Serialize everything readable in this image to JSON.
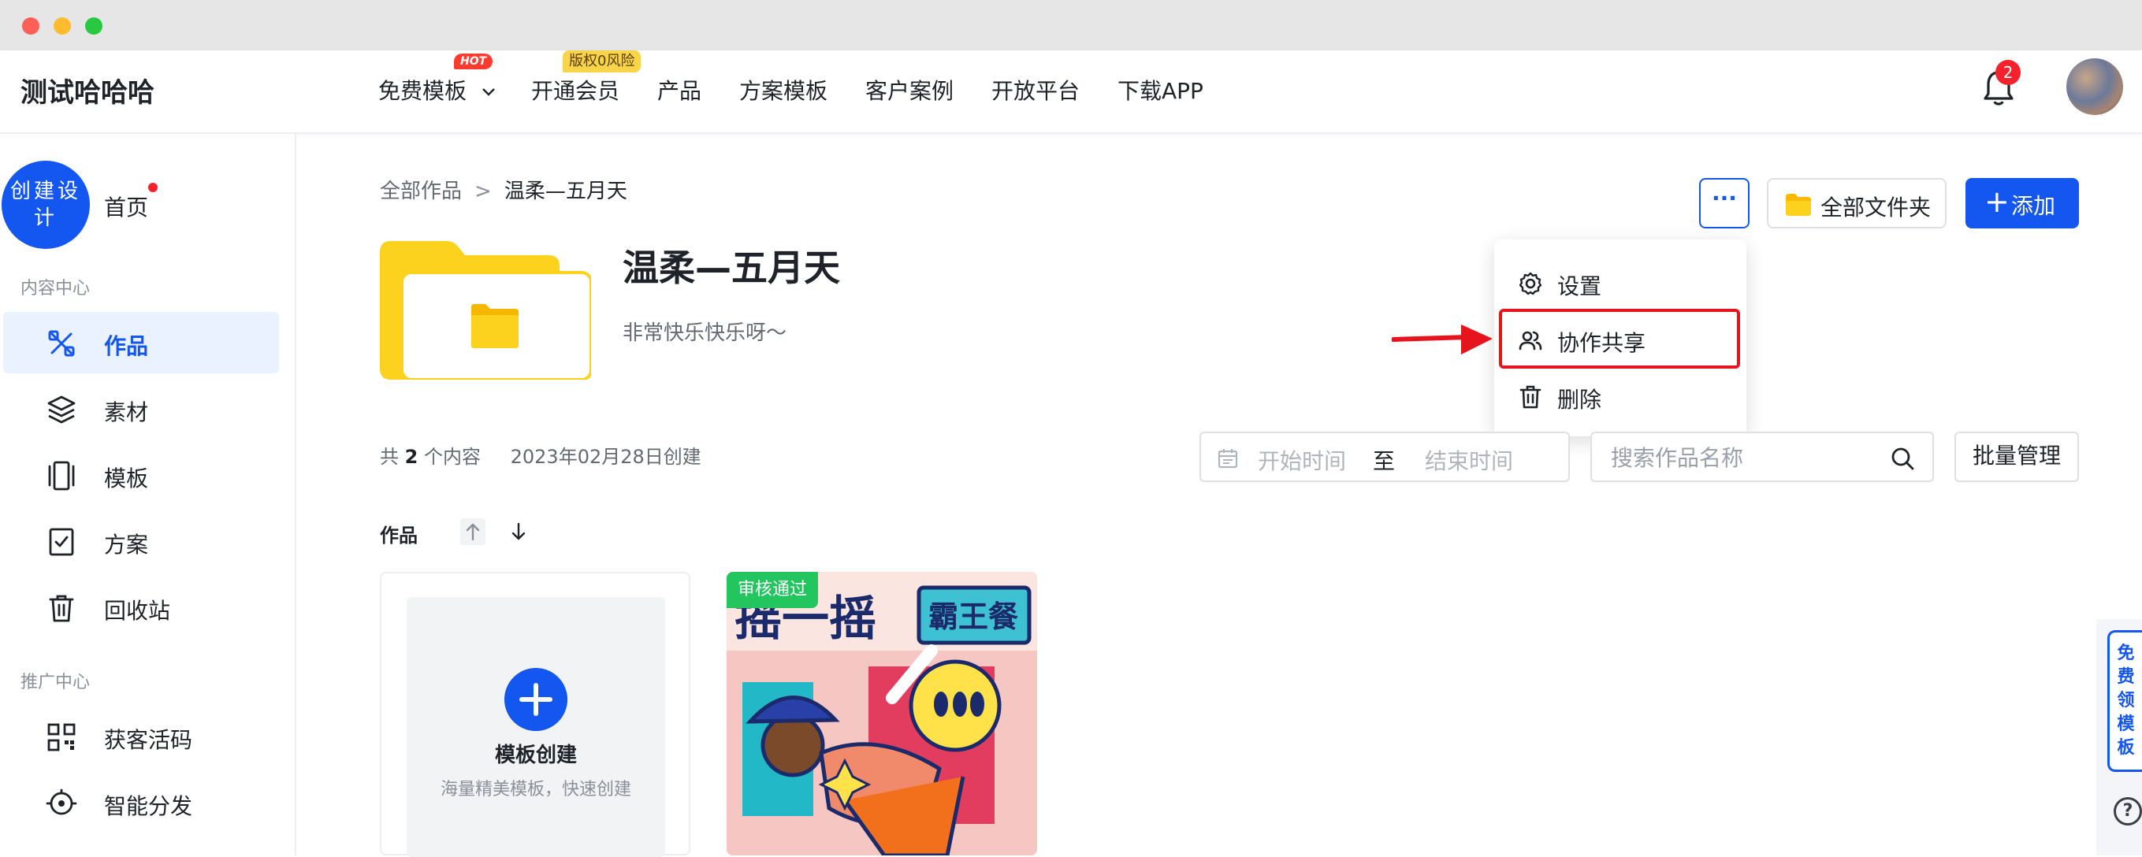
{
  "app": {
    "brand": "测试哈哈哈"
  },
  "nav": {
    "items": [
      {
        "label": "免费模板"
      },
      {
        "label": "开通会员"
      },
      {
        "label": "产品"
      },
      {
        "label": "方案模板"
      },
      {
        "label": "客户案例"
      },
      {
        "label": "开放平台"
      },
      {
        "label": "下载APP"
      }
    ],
    "hot_badge": "HOT",
    "vip_badge": "版权0风险",
    "notification_count": "2"
  },
  "sidebar": {
    "create_button": "创建设计",
    "home": "首页",
    "section_content": "内容中心",
    "items": [
      {
        "label": "作品",
        "icon": "works-icon",
        "active": true
      },
      {
        "label": "素材",
        "icon": "layers-icon"
      },
      {
        "label": "模板",
        "icon": "template-icon"
      },
      {
        "label": "方案",
        "icon": "checklist-icon"
      },
      {
        "label": "回收站",
        "icon": "trash-icon"
      }
    ],
    "section_promo": "推广中心",
    "promo_items": [
      {
        "label": "获客活码",
        "icon": "qrcode-icon"
      },
      {
        "label": "智能分发",
        "icon": "distribute-icon"
      }
    ]
  },
  "breadcrumb": {
    "root": "全部作品",
    "separator": ">",
    "current": "温柔—五月天"
  },
  "folder": {
    "title": "温柔—五月天",
    "description": "非常快乐快乐呀～"
  },
  "toolbar": {
    "more_label": "···",
    "all_folders_label": "全部文件夹",
    "add_label": "添加"
  },
  "menu": {
    "items": [
      {
        "label": "设置",
        "icon": "gear-icon"
      },
      {
        "label": "协作共享",
        "icon": "users-icon"
      },
      {
        "label": "删除",
        "icon": "trash-icon"
      }
    ]
  },
  "summary": {
    "prefix": "共",
    "count": "2",
    "suffix": "个内容",
    "created": "2023年02月28日创建"
  },
  "filters": {
    "start_placeholder": "开始时间",
    "to_label": "至",
    "end_placeholder": "结束时间",
    "search_placeholder": "搜索作品名称",
    "batch_label": "批量管理"
  },
  "works": {
    "label": "作品",
    "create_card": {
      "title": "模板创建",
      "subtitle": "海量精美模板，快速创建"
    },
    "status_badge": "审核通过"
  },
  "float": {
    "free_tab": "免费领模板",
    "help": "?"
  },
  "colors": {
    "primary": "#1456f0",
    "danger": "#e5141d",
    "success": "#22c55e",
    "folder": "#fcd21f"
  }
}
